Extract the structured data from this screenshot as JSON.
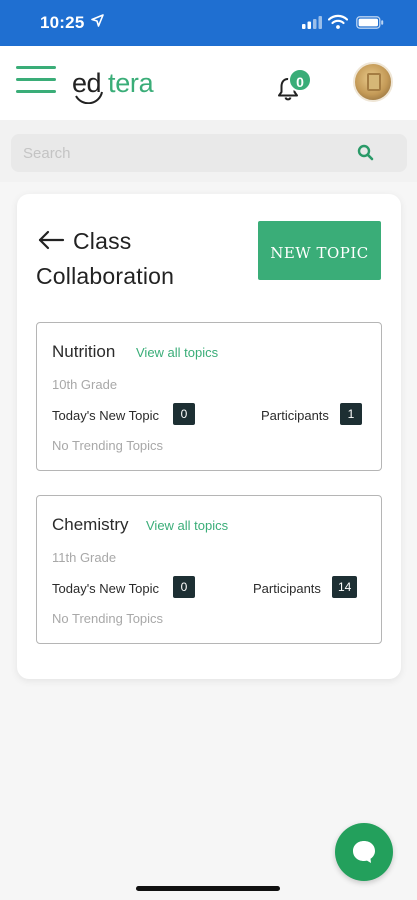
{
  "status_bar": {
    "time": "10:25",
    "icons": [
      "location-arrow-icon",
      "cellular-signal-icon",
      "wifi-icon",
      "battery-icon"
    ]
  },
  "header": {
    "logo_prefix": "ed",
    "logo_suffix": "tera",
    "notification_count": "0",
    "icons": [
      "hamburger-menu-icon",
      "bell-icon"
    ]
  },
  "search": {
    "placeholder": "Search",
    "icon": "search-icon"
  },
  "page": {
    "title": "Class Collaboration",
    "back_icon": "arrow-left-icon",
    "new_topic_label": "NEW TOPIC"
  },
  "subjects": [
    {
      "name": "Nutrition",
      "view_all": "View all topics",
      "grade": "10th Grade",
      "new_topic_label": "Today's New Topic",
      "new_topic_count": "0",
      "participants_label": "Participants",
      "participants_count": "1",
      "trending": "No Trending Topics"
    },
    {
      "name": "Chemistry",
      "view_all": "View all topics",
      "grade": "11th Grade",
      "new_topic_label": "Today's New Topic",
      "new_topic_count": "0",
      "participants_label": "Participants",
      "participants_count": "14",
      "trending": "No Trending Topics"
    }
  ],
  "chat_icon": "chat-bubble-icon",
  "colors": {
    "status_bar": "#1f6fd1",
    "accent_green": "#3aad78",
    "count_badge": "#1d2f33",
    "chat_button": "#23a05c"
  }
}
